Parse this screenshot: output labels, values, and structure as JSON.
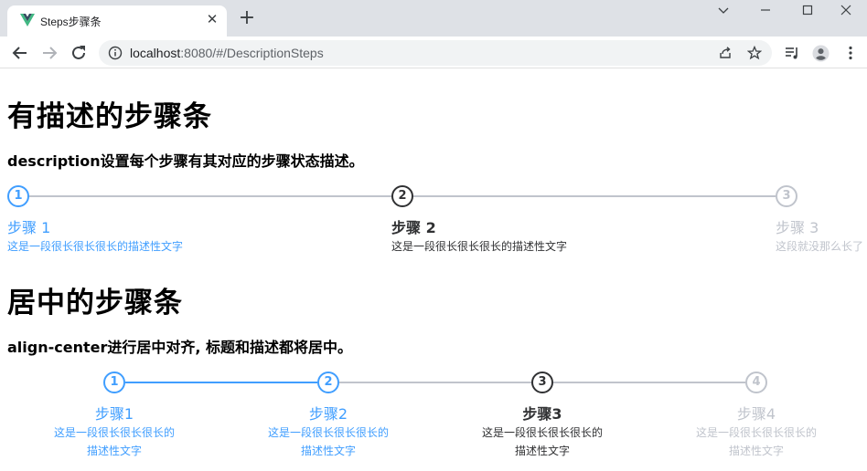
{
  "browser": {
    "tab_title": "Steps步骤条",
    "url_host": "localhost",
    "url_rest": ":8080/#/DescriptionSteps"
  },
  "section1": {
    "title": "有描述的步骤条",
    "subtitle": "description设置每个步骤有其对应的步骤状态描述。",
    "steps": [
      {
        "num": "1",
        "title": "步骤 1",
        "desc": "这是一段很长很长很长的描述性文字",
        "status": "finish"
      },
      {
        "num": "2",
        "title": "步骤 2",
        "desc": "这是一段很长很长很长的描述性文字",
        "status": "process"
      },
      {
        "num": "3",
        "title": "步骤 3",
        "desc": "这段就没那么长了",
        "status": "wait"
      }
    ]
  },
  "section2": {
    "title": "居中的步骤条",
    "subtitle": "align-center进行居中对齐, 标题和描述都将居中。",
    "steps": [
      {
        "num": "1",
        "title": "步骤1",
        "desc_line1": "这是一段很长很长很长的",
        "desc_line2": "描述性文字",
        "status": "finish"
      },
      {
        "num": "2",
        "title": "步骤2",
        "desc_line1": "这是一段很长很长很长的",
        "desc_line2": "描述性文字",
        "status": "finish"
      },
      {
        "num": "3",
        "title": "步骤3",
        "desc_line1": "这是一段很长很长很长的",
        "desc_line2": "描述性文字",
        "status": "process"
      },
      {
        "num": "4",
        "title": "步骤4",
        "desc_line1": "这是一段很长很长很长的",
        "desc_line2": "描述性文字",
        "status": "wait"
      }
    ]
  },
  "colors": {
    "finish": "#409eff",
    "process": "#303133",
    "wait": "#c0c4cc"
  }
}
